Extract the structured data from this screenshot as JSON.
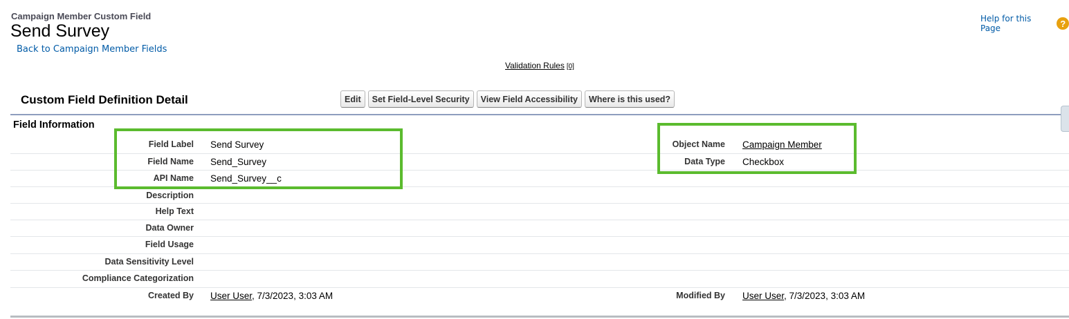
{
  "header": {
    "object_type": "Campaign Member Custom Field",
    "title": "Send Survey",
    "back_link": "Back to Campaign Member Fields",
    "help_link": "Help for this Page",
    "help_icon": "?"
  },
  "related": {
    "validation_rules_label": "Validation Rules",
    "validation_rules_count": "[0]"
  },
  "detail": {
    "title": "Custom Field Definition Detail",
    "buttons": {
      "edit": "Edit",
      "set_fls": "Set Field-Level Security",
      "view_access": "View Field Accessibility",
      "where_used": "Where is this used?"
    },
    "section_title": "Field Information",
    "labels": {
      "field_label": "Field Label",
      "field_name": "Field Name",
      "api_name": "API Name",
      "description": "Description",
      "help_text": "Help Text",
      "data_owner": "Data Owner",
      "field_usage": "Field Usage",
      "data_sensitivity": "Data Sensitivity Level",
      "compliance": "Compliance Categorization",
      "created_by": "Created By",
      "object_name": "Object Name",
      "data_type": "Data Type",
      "modified_by": "Modified By"
    },
    "values": {
      "field_label": "Send Survey",
      "field_name": "Send_Survey",
      "api_name": "Send_Survey__c",
      "object_name": "Campaign Member",
      "data_type": "Checkbox",
      "created_by_user": "User User",
      "created_by_date": ", 7/3/2023, 3:03 AM",
      "modified_by_user": "User User",
      "modified_by_date": ", 7/3/2023, 3:03 AM"
    }
  },
  "colors": {
    "link": "#015ba7",
    "highlight": "#5bbb2e",
    "help_icon": "#e8a10f",
    "section_rule": "#8e9dbe"
  }
}
